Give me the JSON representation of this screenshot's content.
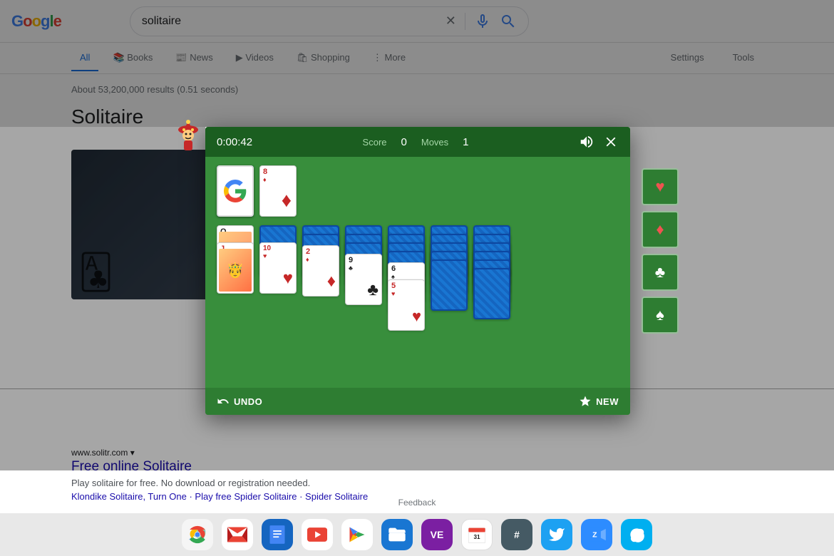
{
  "search": {
    "query": "solitaire",
    "results_count": "About 53,200,000 results (0.51 seconds)",
    "tabs": [
      {
        "label": "All",
        "active": true
      },
      {
        "label": "Books",
        "icon": "📚"
      },
      {
        "label": "News",
        "icon": "📰"
      },
      {
        "label": "Videos",
        "icon": "▶"
      },
      {
        "label": "Shopping",
        "icon": "🛍"
      },
      {
        "label": "More",
        "icon": "⋮"
      }
    ],
    "settings_label": "Settings",
    "tools_label": "Tools"
  },
  "solitaire_result": {
    "title": "Solitaire",
    "site_url": "www.solitr.com",
    "site_arrow": "▾",
    "link_text": "Free online Solitaire",
    "snippet": "Play solitaire for free. No download or registration needed.",
    "sub_links": "Klondike Solitaire, Turn One · Play free Spider Solitaire · Spider Solitaire"
  },
  "game": {
    "timer": "0:00:42",
    "score_label": "Score",
    "score_value": "0",
    "moves_label": "Moves",
    "moves_value": "1",
    "undo_label": "UNDO",
    "new_label": "NEW",
    "foundation_suits": [
      "♥",
      "♦",
      "♣",
      "♠"
    ],
    "stock_cards": [
      "Google G"
    ],
    "waste_top": {
      "rank": "8",
      "suit": "♦",
      "color": "red"
    },
    "columns": [
      {
        "face_up": [
          {
            "rank": "Q",
            "suit": "♣",
            "color": "black"
          },
          {
            "rank": "J",
            "suit": "♥",
            "color": "red"
          }
        ],
        "face_down": 0
      },
      {
        "face_up": [
          {
            "rank": "10",
            "suit": "♥",
            "color": "red"
          }
        ],
        "face_down": 1
      },
      {
        "face_up": [
          {
            "rank": "2",
            "suit": "♦",
            "color": "red"
          }
        ],
        "face_down": 2
      },
      {
        "face_up": [
          {
            "rank": "9",
            "suit": "♣",
            "color": "black"
          }
        ],
        "face_down": 3
      },
      {
        "face_up": [
          {
            "rank": "6",
            "suit": "♠",
            "color": "black"
          },
          {
            "rank": "5",
            "suit": "♥",
            "color": "red"
          }
        ],
        "face_down": 4
      },
      {
        "face_up": [],
        "face_down": 5
      }
    ]
  },
  "feedback": {
    "label": "Feedback"
  },
  "taskbar": {
    "icons": [
      {
        "name": "chrome",
        "color": "#4285f4",
        "symbol": "⊙"
      },
      {
        "name": "gmail",
        "color": "#ea4335",
        "symbol": "M"
      },
      {
        "name": "docs",
        "color": "#4285f4",
        "symbol": "≡"
      },
      {
        "name": "youtube",
        "color": "#ea4335",
        "symbol": "▶"
      },
      {
        "name": "play",
        "color": "#00c853",
        "symbol": "▷"
      },
      {
        "name": "files",
        "color": "#1976d2",
        "symbol": "📁"
      },
      {
        "name": "ve",
        "color": "#7b1fa2",
        "symbol": "VE"
      },
      {
        "name": "calendar",
        "color": "#1976d2",
        "symbol": "31"
      },
      {
        "name": "calculator",
        "color": "#37474f",
        "symbol": "#"
      },
      {
        "name": "twitter",
        "color": "#1da1f2",
        "symbol": "t"
      },
      {
        "name": "zoom",
        "color": "#2196f3",
        "symbol": "Z"
      },
      {
        "name": "skype",
        "color": "#00aff0",
        "symbol": "S"
      }
    ]
  }
}
